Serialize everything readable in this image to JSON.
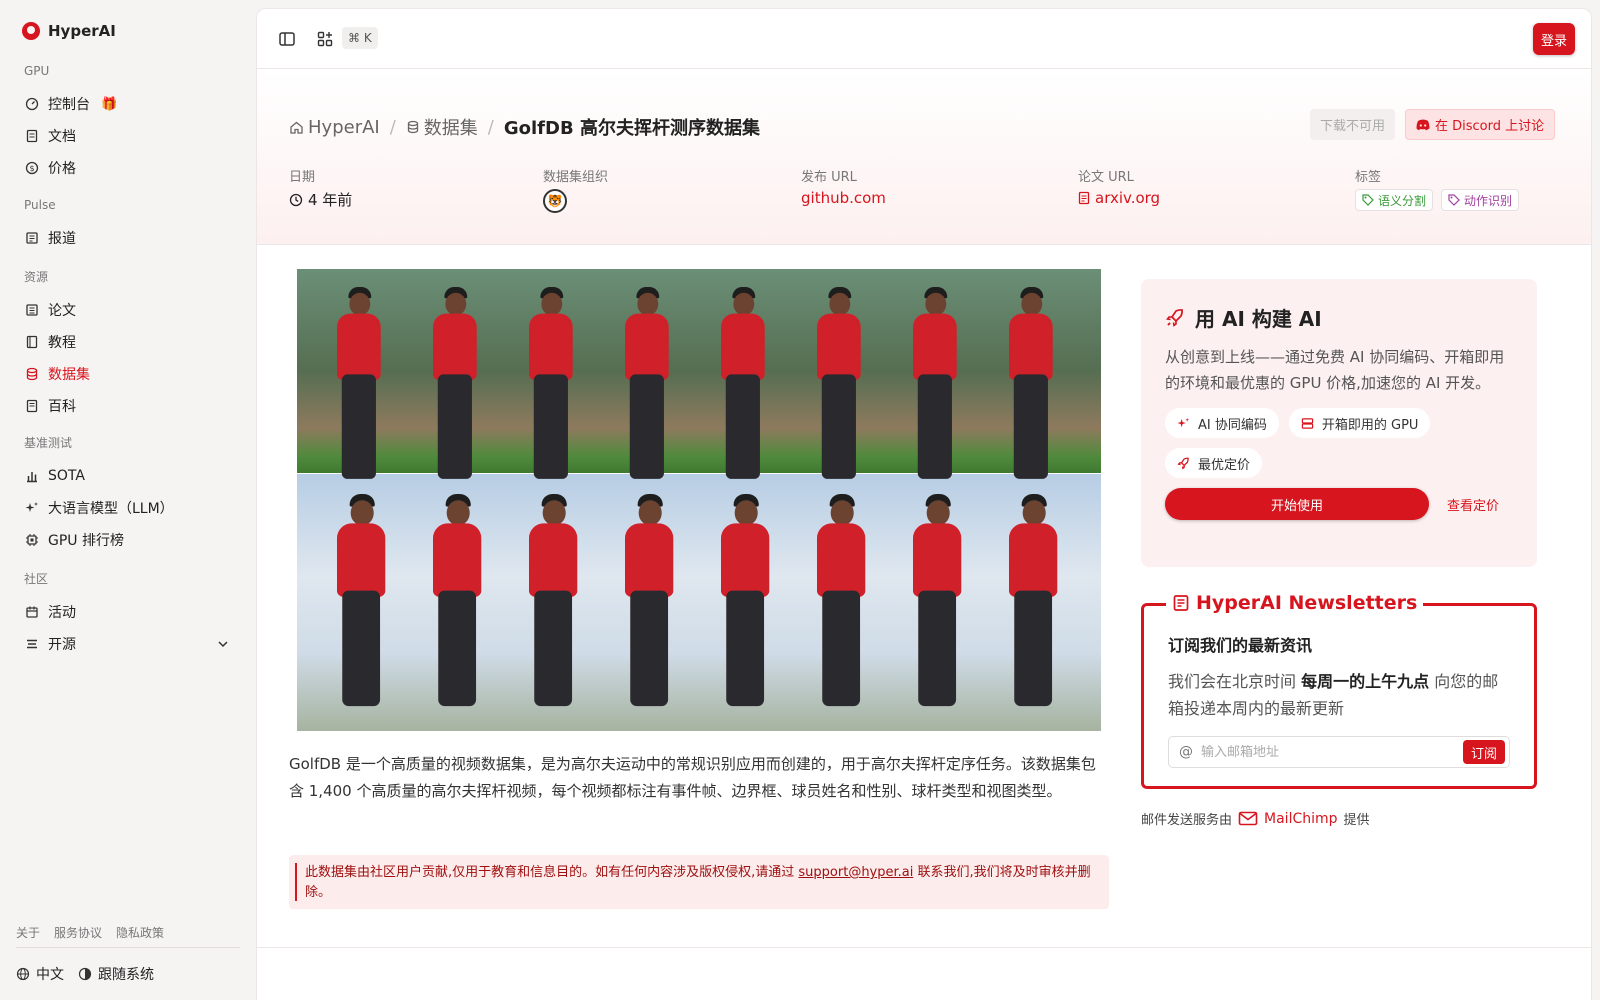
{
  "brand": {
    "name": "HyperAI"
  },
  "sidebar": {
    "sections": [
      {
        "title": "GPU",
        "items": [
          {
            "label": "控制台"
          },
          {
            "label": "文档"
          },
          {
            "label": "价格"
          }
        ]
      },
      {
        "title": "Pulse",
        "items": [
          {
            "label": "报道"
          }
        ]
      },
      {
        "title": "资源",
        "items": [
          {
            "label": "论文"
          },
          {
            "label": "教程"
          },
          {
            "label": "数据集"
          },
          {
            "label": "百科"
          }
        ]
      },
      {
        "title": "基准测试",
        "items": [
          {
            "label": "SOTA"
          },
          {
            "label": "大语言模型（LLM）"
          },
          {
            "label": "GPU 排行榜"
          }
        ]
      },
      {
        "title": "社区",
        "items": [
          {
            "label": "活动"
          },
          {
            "label": "开源"
          }
        ]
      }
    ],
    "footer_links": [
      "关于",
      "服务协议",
      "隐私政策"
    ],
    "language": "中文",
    "theme": "跟随系统"
  },
  "topbar": {
    "shortcut": "⌘ K",
    "login_label": "登录"
  },
  "breadcrumb": {
    "home": "HyperAI",
    "section": "数据集",
    "current": "GolfDB 高尔夫挥杆测序数据集"
  },
  "header_actions": {
    "download": "下载不可用",
    "discord": "在 Discord 上讨论"
  },
  "meta": {
    "date_label": "日期",
    "date_value": "4 年前",
    "org_label": "数据集组织",
    "release_label": "发布 URL",
    "release_value": "github.com",
    "paper_label": "论文 URL",
    "paper_value": "arxiv.org",
    "tags_label": "标签",
    "tags": [
      "语义分割",
      "动作识别"
    ]
  },
  "description": "GolfDB 是一个高质量的视频数据集，是为高尔夫运动中的常规识别应用而创建的，用于高尔夫挥杆定序任务。该数据集包含 1,400 个高质量的高尔夫挥杆视频，每个视频都标注有事件帧、边界框、球员姓名和性别、球杆类型和视图类型。",
  "notice": {
    "before": "此数据集由社区用户贡献,仅用于教育和信息目的。如有任何内容涉及版权侵权,请通过 ",
    "email": "support@hyper.ai",
    "after": " 联系我们,我们将及时审核并删除。"
  },
  "promo": {
    "title": "用 AI 构建 AI",
    "desc": "从创意到上线——通过免费 AI 协同编码、开箱即用的环境和最优惠的 GPU 价格,加速您的 AI 开发。",
    "chips": [
      "AI 协同编码",
      "开箱即用的 GPU",
      "最优定价"
    ],
    "start": "开始使用",
    "pricing": "查看定价"
  },
  "newsletter": {
    "title": "HyperAI Newsletters",
    "heading": "订阅我们的最新资讯",
    "text_before": "我们会在北京时间 ",
    "text_bold": "每周一的上午九点",
    "text_after": " 向您的邮箱投递本周内的最新更新",
    "placeholder": "输入邮箱地址",
    "subscribe": "订阅",
    "provider_before": "邮件发送服务由",
    "provider": "MailChimp",
    "provider_after": "提供"
  },
  "colors": {
    "accent": "#d7151e"
  }
}
